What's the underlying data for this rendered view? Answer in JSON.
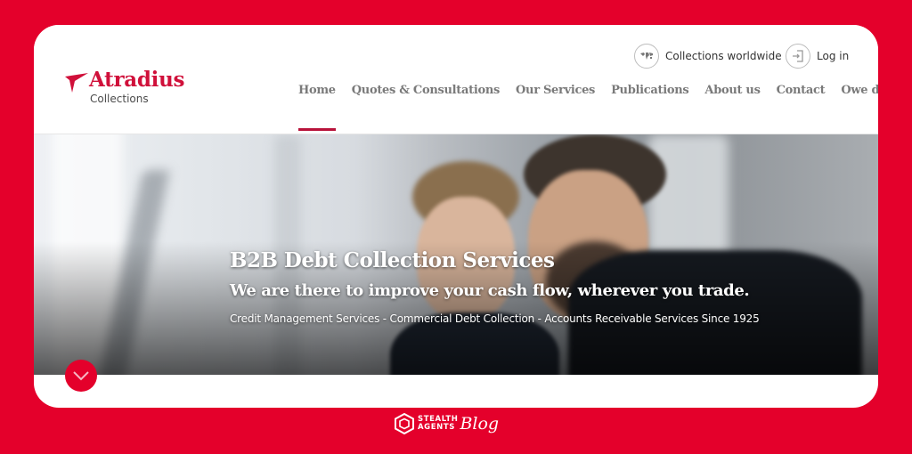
{
  "colors": {
    "frame": "#e4002b",
    "brand_red": "#d0103a",
    "nav_text": "#7a7a7a",
    "active_underline": "#b8123a"
  },
  "logo": {
    "name": "Atradius",
    "subtitle": "Collections",
    "icon": "atradius-bird-icon"
  },
  "utility": {
    "worldwide": {
      "label": "Collections worldwide",
      "icon": "world-map-icon"
    },
    "login": {
      "label": "Log in",
      "icon": "login-icon"
    }
  },
  "nav": {
    "items": [
      {
        "label": "Home",
        "active": true
      },
      {
        "label": "Quotes & Consultations",
        "active": false
      },
      {
        "label": "Our Services",
        "active": false
      },
      {
        "label": "Publications",
        "active": false
      },
      {
        "label": "About us",
        "active": false
      },
      {
        "label": "Contact",
        "active": false
      },
      {
        "label": "Owe debts?",
        "active": false
      }
    ]
  },
  "hero": {
    "title": "B2B Debt Collection Services",
    "subtitle": "We are there to improve your cash flow, wherever you trade.",
    "tagline": "Credit Management Services - Commercial Debt Collection - Accounts Receivable Services Since 1925",
    "scroll_icon": "chevron-down-icon"
  },
  "branding": {
    "line1": "STEALTH",
    "line2": "AGENTS",
    "script": "Blog"
  }
}
